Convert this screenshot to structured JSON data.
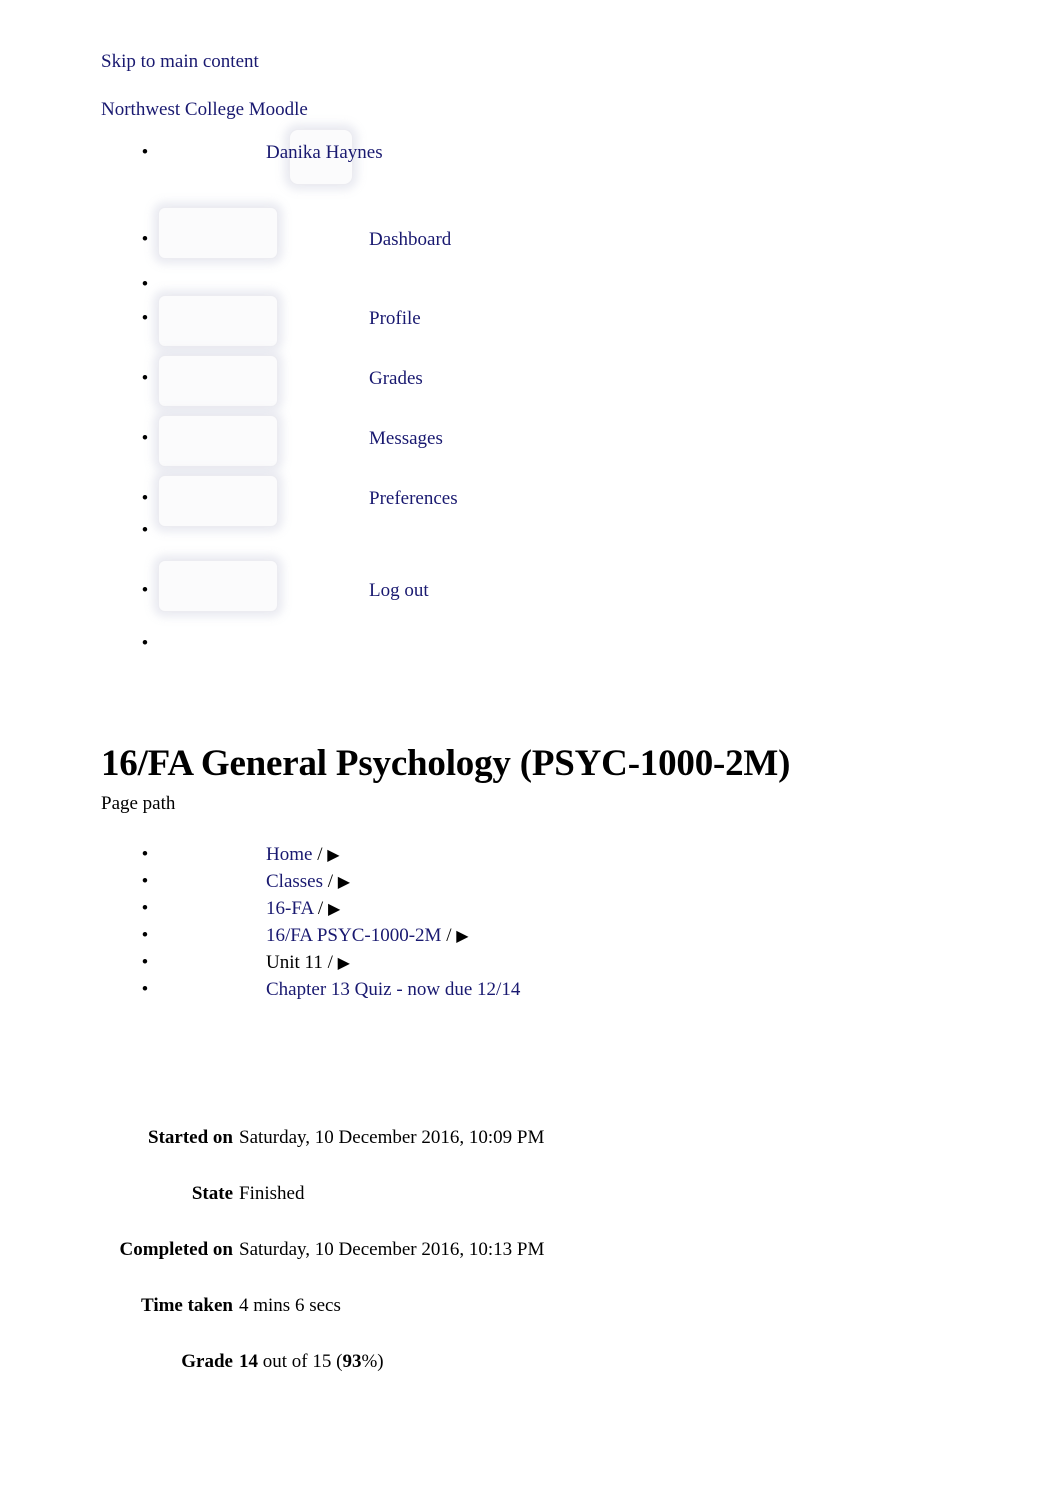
{
  "accessibility": {
    "skip_link": "Skip to main content"
  },
  "header": {
    "site_name": "Northwest College Moodle",
    "user_name": "Danika Haynes",
    "avatar_icon": "user-avatar-placeholder-icon"
  },
  "user_menu": {
    "items": [
      {
        "label": "Dashboard",
        "icon": "dashboard-icon",
        "has_icon": true
      },
      {
        "label": "",
        "icon": "menu-divider",
        "has_icon": false
      },
      {
        "label": "Profile",
        "icon": "profile-icon",
        "has_icon": true
      },
      {
        "label": "Grades",
        "icon": "grades-icon",
        "has_icon": true
      },
      {
        "label": "Messages",
        "icon": "messages-icon",
        "has_icon": true
      },
      {
        "label": "Preferences",
        "icon": "preferences-icon",
        "has_icon": true
      },
      {
        "label": "",
        "icon": "menu-divider",
        "has_icon": false
      },
      {
        "label": "Log out",
        "icon": "logout-icon",
        "has_icon": true
      },
      {
        "label": "",
        "icon": "menu-divider",
        "has_icon": false
      }
    ]
  },
  "page": {
    "title": "16/FA General Psychology (PSYC-1000-2M)",
    "page_path_label": "Page path"
  },
  "breadcrumb": {
    "items": [
      {
        "label": "Home",
        "is_link": true,
        "separator": "/",
        "arrow": "▶"
      },
      {
        "label": "Classes",
        "is_link": true,
        "separator": "/",
        "arrow": "▶"
      },
      {
        "label": "16-FA",
        "is_link": true,
        "separator": "/",
        "arrow": "▶"
      },
      {
        "label": "16/FA PSYC-1000-2M",
        "is_link": true,
        "separator": "/",
        "arrow": "▶"
      },
      {
        "label": "Unit 11",
        "is_link": false,
        "separator": "/",
        "arrow": "▶"
      },
      {
        "label": "Chapter 13 Quiz - now due 12/14",
        "is_link": true,
        "separator": "",
        "arrow": ""
      }
    ]
  },
  "quiz_summary": {
    "rows": [
      {
        "label": "Started on",
        "value": "Saturday, 10 December 2016, 10:09 PM"
      },
      {
        "label": "State",
        "value": "Finished"
      },
      {
        "label": "Completed on",
        "value": "Saturday, 10 December 2016, 10:13 PM"
      },
      {
        "label": "Time taken",
        "value": "4 mins 6 secs"
      }
    ],
    "grade": {
      "label": "Grade",
      "points_earned": "14",
      "middle_text": " out of 15 (",
      "percent": "93",
      "suffix": "%)"
    }
  },
  "colors": {
    "link": "#191970",
    "text": "#000000",
    "background": "#ffffff",
    "placeholder_fill": "#fbfbfc",
    "placeholder_border": "#e8e8ee"
  }
}
